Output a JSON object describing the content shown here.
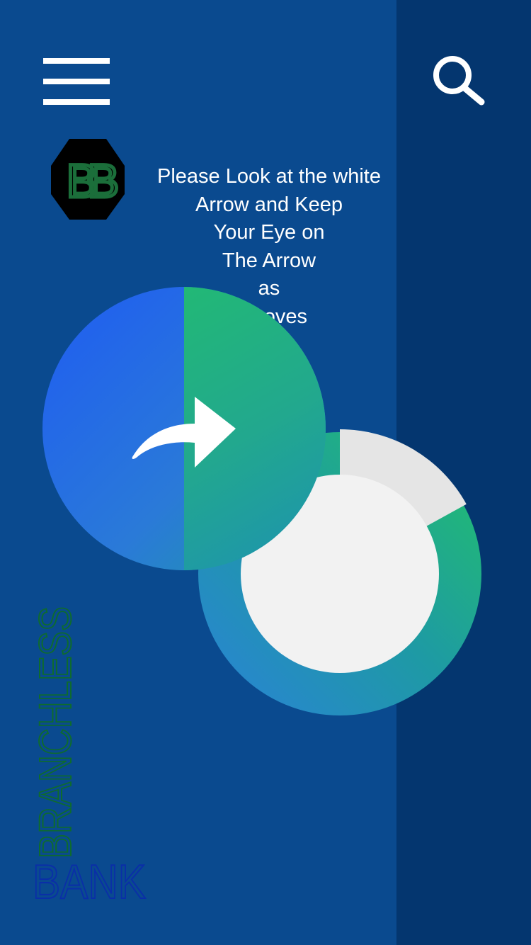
{
  "app": {
    "brand_name_line1": "BRANCHLESS",
    "brand_name_line2": "BANK",
    "logo_text": "BB"
  },
  "header": {
    "menu_icon": "hamburger-menu-icon",
    "search_icon": "search-icon"
  },
  "instruction": {
    "lines": [
      "Please Look at the white",
      "Arrow and Keep",
      "Your Eye on",
      "The Arrow",
      "as",
      "it moves"
    ]
  },
  "dial": {
    "icon": "curved-arrow-right-icon"
  },
  "progress": {
    "segments": [
      {
        "name": "complete",
        "fraction": 0.92
      },
      {
        "name": "remaining",
        "fraction": 0.08
      }
    ],
    "remaining_start_fraction": 0.0,
    "remaining_end_fraction": 0.17
  },
  "colors": {
    "background": "#0a4a8f",
    "side_panel": "#04366f",
    "gradient_blue": "#1f5cf2",
    "gradient_green": "#22c169",
    "gradient_teal": "#1e9aa4",
    "ring_track": "#e5e5e5",
    "ring_center": "#f2f2f2",
    "logo_green": "#1b6e3a",
    "wordmark_green": "#0e6b2e",
    "wordmark_blue": "#0a2ea8"
  }
}
